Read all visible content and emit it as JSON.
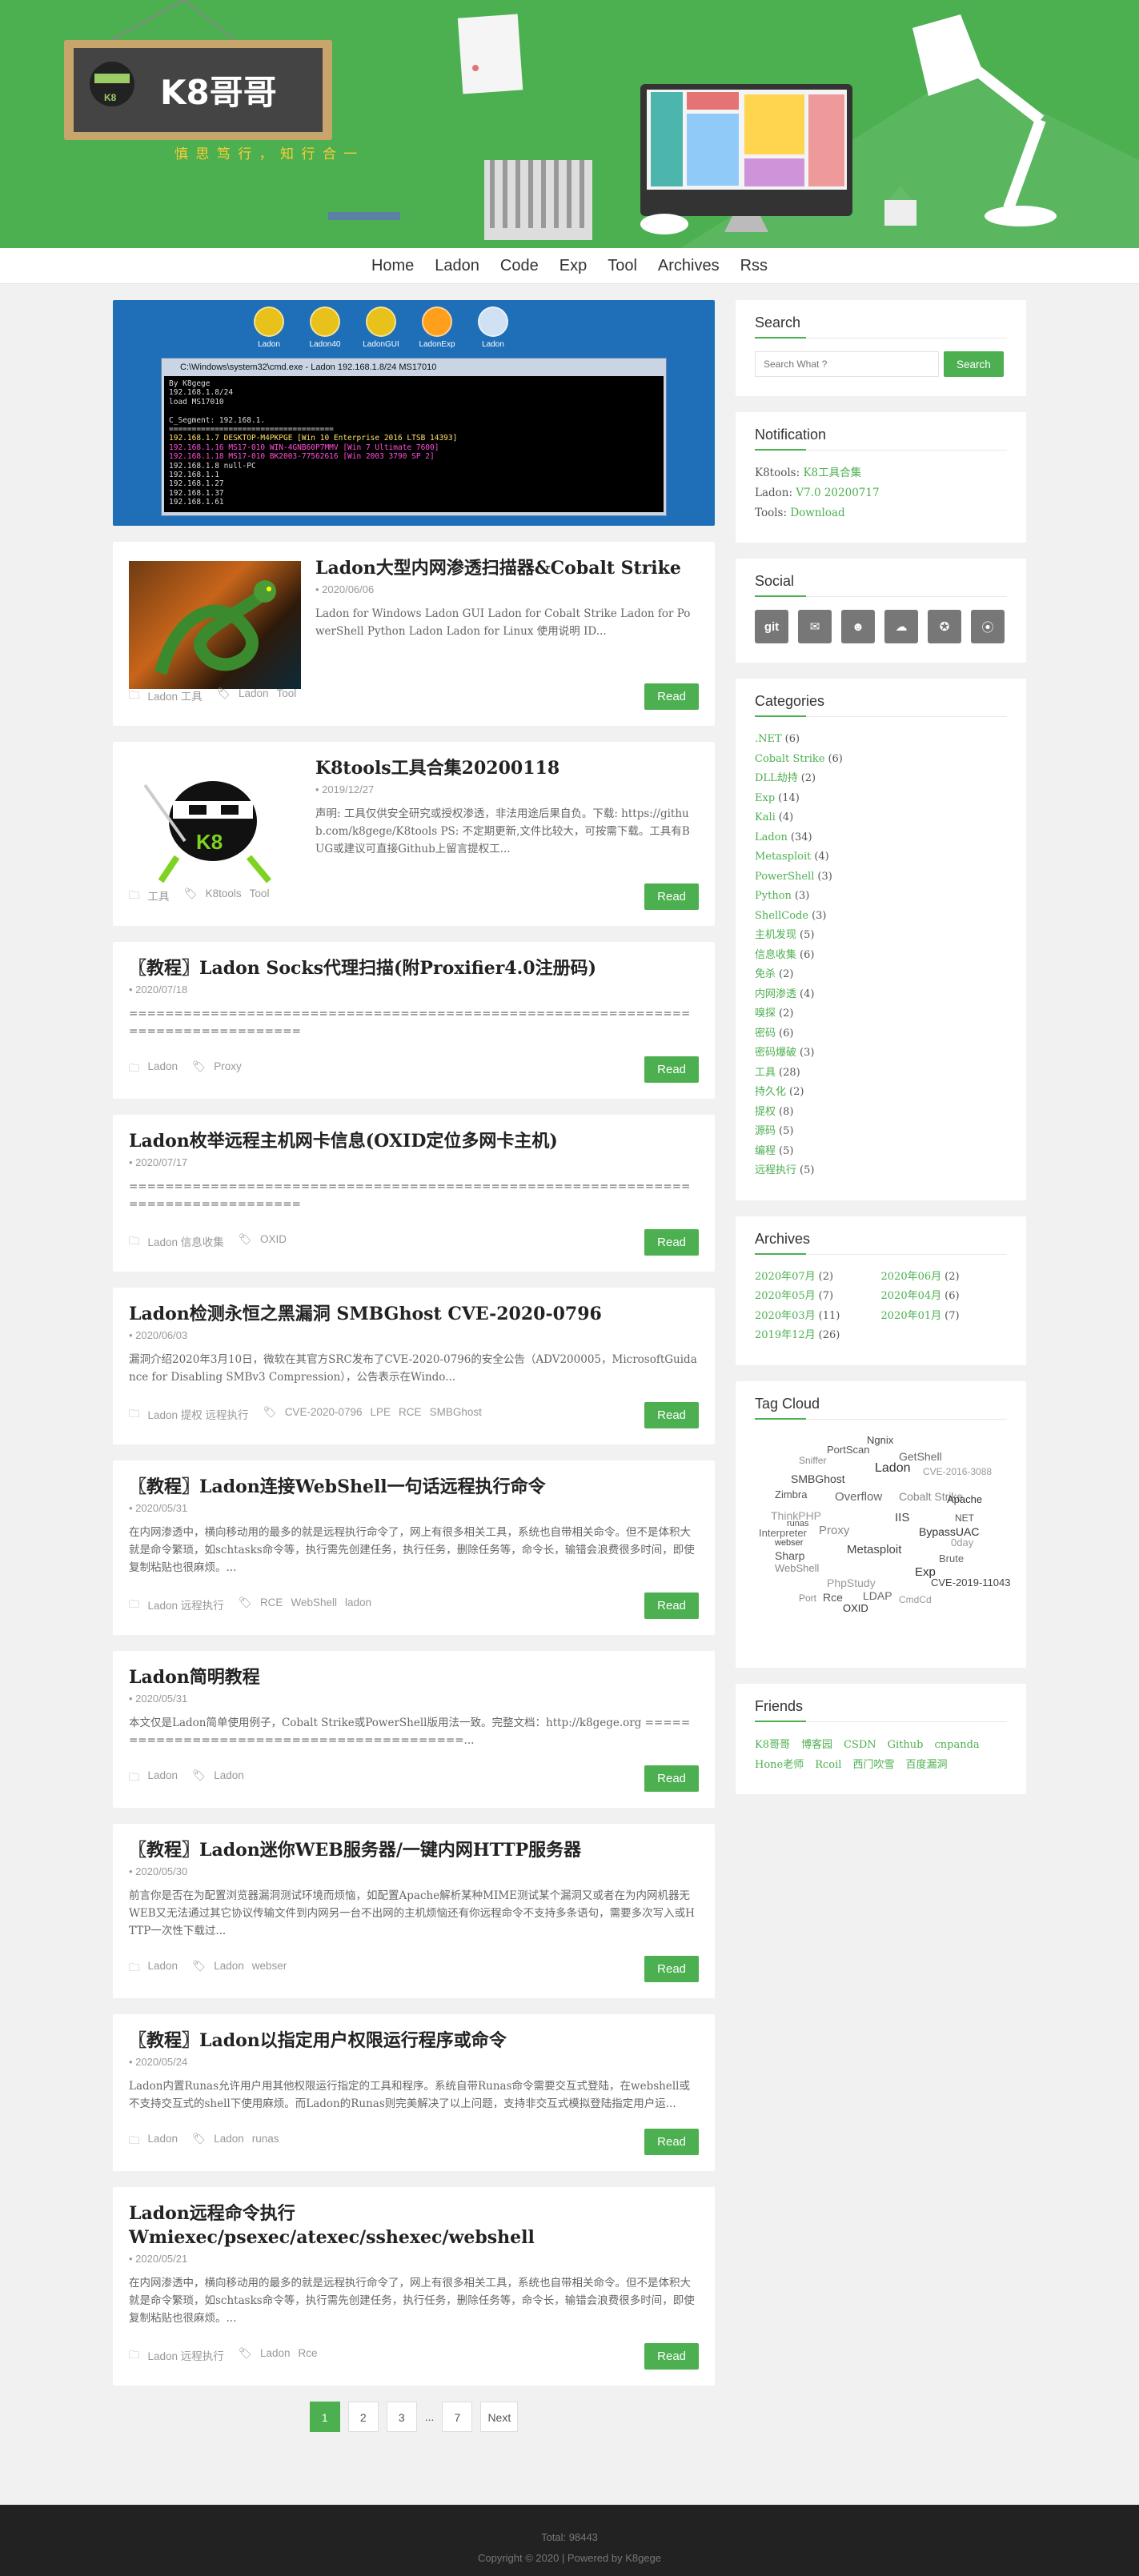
{
  "brand": {
    "title": "K8哥哥",
    "subtitle": "慎 思 笃 行 ， 知 行 合 一"
  },
  "nav": [
    "Home",
    "Ladon",
    "Code",
    "Exp",
    "Tool",
    "Archives",
    "Rss"
  ],
  "banner": {
    "icons": [
      "Ladon",
      "Ladon40",
      "LadonGUI",
      "LadonExp",
      "Ladon"
    ],
    "window_title": "C:\\Windows\\system32\\cmd.exe - Ladon 192.168.1.8/24 MS17010",
    "console": [
      "By K8gege",
      "192.168.1.8/24",
      "load MS17010",
      "",
      "C_Segment: 192.168.1.",
      "====================================",
      "192.168.1.7 DESKTOP-M4PKPGE [Win 10 Enterprise 2016 LTSB 14393]",
      "192.168.1.16 MS17-010 WIN-4GNB60P7MMV [Win 7 Ultimate 7600]",
      "192.168.1.18 MS17-010 BK2003-77562616 [Win 2003 3790 SP 2]",
      "192.168.1.8 null-PC",
      "192.168.1.1",
      "192.168.1.27",
      "192.168.1.37",
      "192.168.1.61"
    ]
  },
  "read_label": "Read",
  "posts": [
    {
      "title": "Ladon大型内网渗透扫描器&Cobalt Strike",
      "date": "2020/06/06",
      "excerpt": "Ladon for Windows Ladon GUI Ladon for Cobalt Strike Ladon for PowerShell Python Ladon Ladon for Linux 使用说明 ID...",
      "cats": "Ladon 工具",
      "tags": [
        "Ladon",
        "Tool"
      ],
      "thumb": "dragon"
    },
    {
      "title": "K8tools工具合集20200118",
      "date": "2019/12/27",
      "excerpt": "声明: 工具仅供安全研究或授权渗透，非法用途后果自负。下载: https://github.com/k8gege/K8tools PS: 不定期更新,文件比较大，可按需下载。工具有BUG或建议可直接Github上留言提权工...",
      "cats": "工具",
      "tags": [
        "K8tools",
        "Tool"
      ],
      "thumb": "ninja"
    },
    {
      "title": "〖教程〗Ladon Socks代理扫描(附Proxifier4.0注册码)",
      "date": "2020/07/18",
      "excerpt": "=================================================================================",
      "cats": "Ladon",
      "tags": [
        "Proxy"
      ]
    },
    {
      "title": "Ladon枚举远程主机网卡信息(OXID定位多网卡主机)",
      "date": "2020/07/17",
      "excerpt": "=================================================================================",
      "cats": "Ladon 信息收集",
      "tags": [
        "OXID"
      ]
    },
    {
      "title": "Ladon检测永恒之黑漏洞 SMBGhost CVE-2020-0796",
      "date": "2020/06/03",
      "excerpt": "漏洞介绍2020年3月10日，微软在其官方SRC发布了CVE-2020-0796的安全公告（ADV200005，MicrosoftGuidance for Disabling SMBv3 Compression），公告表示在Windo...",
      "cats": "Ladon 提权 远程执行",
      "tags": [
        "CVE-2020-0796",
        "LPE",
        "RCE",
        "SMBGhost"
      ]
    },
    {
      "title": "〖教程〗Ladon连接WebShell一句话远程执行命令",
      "date": "2020/05/31",
      "excerpt": "在内网渗透中，横向移动用的最多的就是远程执行命令了，网上有很多相关工具，系统也自带相关命令。但不是体积大就是命令繁琐，如schtasks命令等，执行需先创建任务，执行任务，删除任务等，命令长，输错会浪费很多时间，即使复制粘贴也很麻烦。...",
      "cats": "Ladon 远程执行",
      "tags": [
        "RCE",
        "WebShell",
        "ladon"
      ]
    },
    {
      "title": "Ladon简明教程",
      "date": "2020/05/31",
      "excerpt": "本文仅是Ladon简单使用例子，Cobalt Strike或PowerShell版用法一致。完整文档：http://k8gege.org ==========================================...",
      "cats": "Ladon",
      "tags": [
        "Ladon"
      ]
    },
    {
      "title": "〖教程〗Ladon迷你WEB服务器/一键内网HTTP服务器",
      "date": "2020/05/30",
      "excerpt": "前言你是否在为配置浏览器漏洞测试环境而烦恼，如配置Apache解析某种MIME测试某个漏洞又或者在为内网机器无WEB又无法通过其它协议传输文件到内网另一台不出网的主机烦恼还有你远程命令不支持多条语句，需要多次写入或HTTP一次性下载过...",
      "cats": "Ladon",
      "tags": [
        "Ladon",
        "webser"
      ]
    },
    {
      "title": "〖教程〗Ladon以指定用户权限运行程序或命令",
      "date": "2020/05/24",
      "excerpt": "Ladon内置Runas允许用户用其他权限运行指定的工具和程序。系统自带Runas命令需要交互式登陆，在webshell或不支持交互式的shell下使用麻烦。而Ladon的Runas则完美解决了以上问题，支持非交互式模拟登陆指定用户运...",
      "cats": "Ladon",
      "tags": [
        "Ladon",
        "runas"
      ]
    },
    {
      "title": "Ladon远程命令执行Wmiexec/psexec/atexec/sshexec/webshell",
      "date": "2020/05/21",
      "excerpt": "在内网渗透中，横向移动用的最多的就是远程执行命令了，网上有很多相关工具，系统也自带相关命令。但不是体积大就是命令繁琐，如schtasks命令等，执行需先创建任务，执行任务，删除任务等，命令长，输错会浪费很多时间，即使复制粘贴也很麻烦。...",
      "cats": "Ladon 远程执行",
      "tags": [
        "Ladon",
        "Rce"
      ]
    }
  ],
  "pager": [
    "1",
    "2",
    "3",
    "...",
    "7",
    "Next"
  ],
  "search": {
    "title": "Search",
    "placeholder": "Search What ?",
    "button": "Search"
  },
  "notification": {
    "title": "Notification",
    "k8tools_label": "K8tools:",
    "k8tools_value": "K8工具合集",
    "ladon_label": "Ladon:",
    "ladon_value": "V7.0 20200717",
    "tools_label": "Tools:",
    "tools_value": "Download"
  },
  "social": {
    "title": "Social",
    "items": [
      "git",
      "mail",
      "qq",
      "wechat",
      "qzone",
      "rss"
    ]
  },
  "categories": {
    "title": "Categories",
    "items": [
      [
        ".NET",
        "(6)"
      ],
      [
        "Cobalt Strike",
        "(6)"
      ],
      [
        "DLL劫持",
        "(2)"
      ],
      [
        "Exp",
        "(14)"
      ],
      [
        "Kali",
        "(4)"
      ],
      [
        "Ladon",
        "(34)"
      ],
      [
        "Metasploit",
        "(4)"
      ],
      [
        "PowerShell",
        "(3)"
      ],
      [
        "Python",
        "(3)"
      ],
      [
        "ShellCode",
        "(3)"
      ],
      [
        "主机发现",
        "(5)"
      ],
      [
        "信息收集",
        "(6)"
      ],
      [
        "免杀",
        "(2)"
      ],
      [
        "内网渗透",
        "(4)"
      ],
      [
        "嗅探",
        "(2)"
      ],
      [
        "密码",
        "(6)"
      ],
      [
        "密码爆破",
        "(3)"
      ],
      [
        "工具",
        "(28)"
      ],
      [
        "持久化",
        "(2)"
      ],
      [
        "提权",
        "(8)"
      ],
      [
        "源码",
        "(5)"
      ],
      [
        "编程",
        "(5)"
      ],
      [
        "远程执行",
        "(5)"
      ]
    ]
  },
  "archives": {
    "title": "Archives",
    "items": [
      [
        "2020年07月",
        "(2)"
      ],
      [
        "2020年06月",
        "(2)"
      ],
      [
        "2020年05月",
        "(7)"
      ],
      [
        "2020年04月",
        "(6)"
      ],
      [
        "2020年03月",
        "(11)"
      ],
      [
        "2020年01月",
        "(7)"
      ],
      [
        "2019年12月",
        "(26)"
      ]
    ]
  },
  "tagcloud": {
    "title": "Tag Cloud",
    "words": [
      "Ngnix",
      "PortScan",
      "GetShell",
      "Sniffer",
      "Ladon",
      "CVE-2016-3088",
      "SMBGhost",
      "Zimbra",
      "Overflow",
      "Cobalt Strike",
      "Apache",
      "ThinkPHP",
      "IIS",
      "NET",
      "Interpreter",
      "Proxy",
      "BypassUAC",
      "0day",
      "Metasploit",
      "Sharp",
      "Brute",
      "WebShell",
      "Exp",
      "PhpStudy",
      "CVE-2019-11043",
      "Rce",
      "LDAP",
      "Port",
      "OXID",
      "CmdCd",
      "webser",
      "runas"
    ]
  },
  "friends": {
    "title": "Friends",
    "items": [
      "K8哥哥",
      "博客园",
      "CSDN",
      "Github",
      "cnpanda",
      "Hone老师",
      "Rcoil",
      "西门吹雪",
      "百度漏洞"
    ]
  },
  "footer": {
    "total": "Total: 98443",
    "copyright": "Copyright © 2020  |  Powered by K8gege"
  }
}
